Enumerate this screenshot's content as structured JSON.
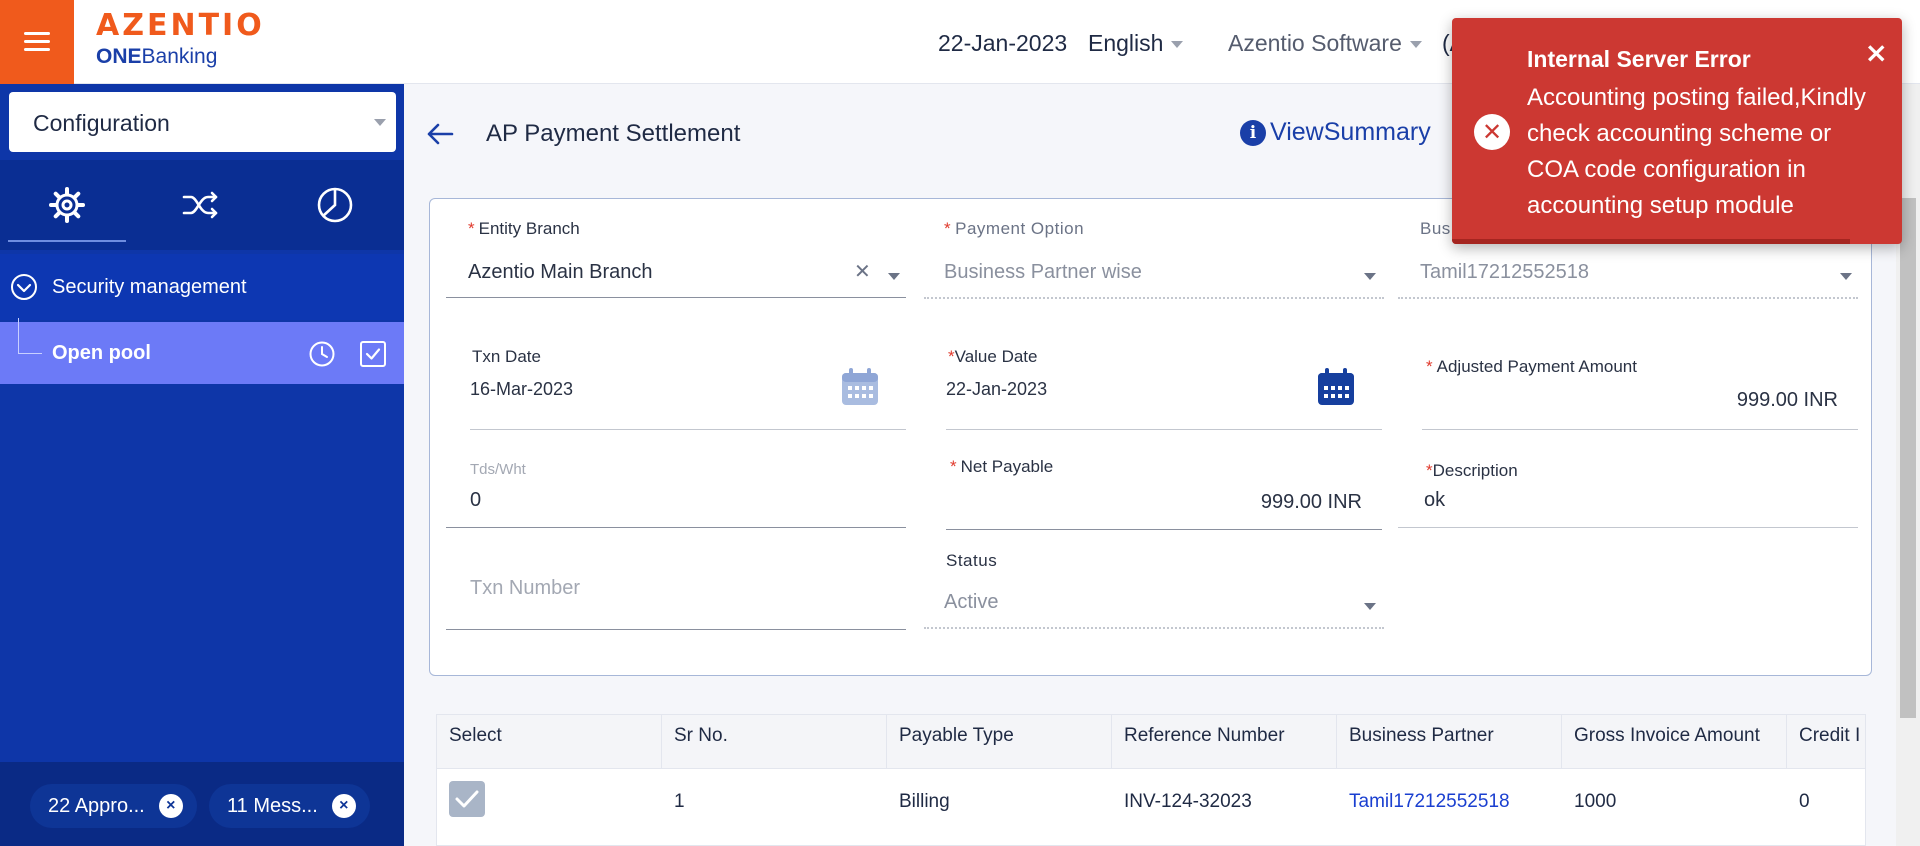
{
  "header": {
    "menu_icon": "hamburger-icon",
    "logo_main": "AZENTIO",
    "logo_sub_bold": "ONE",
    "logo_sub": "Banking",
    "date": "22-Jan-2023",
    "language": "English",
    "company": "Azentio Software",
    "extra": "(A"
  },
  "sidebar": {
    "module": "Configuration",
    "tabs": [
      {
        "icon": "gear-icon"
      },
      {
        "icon": "shuffle-icon"
      },
      {
        "icon": "pie-chart-icon"
      }
    ],
    "group_label": "Security management",
    "item_label": "Open pool",
    "footer": {
      "approvals": "22 Appro...",
      "messages": "11 Mess..."
    }
  },
  "page": {
    "title": "AP Payment Settlement",
    "view_summary": "ViewSummary"
  },
  "form": {
    "entity_branch_label": "Entity Branch",
    "entity_branch_value": "Azentio Main Branch",
    "payment_option_label": "Payment Option",
    "payment_option_value": "Business Partner wise",
    "business_partner_label": "Bus",
    "business_partner_value": "Tamil17212552518",
    "txn_date_label": "Txn Date",
    "txn_date_value": "16-Mar-2023",
    "value_date_label": "Value Date",
    "value_date_value": "22-Jan-2023",
    "adjusted_amount_label": "Adjusted Payment Amount",
    "adjusted_amount_value": "999.00 INR",
    "tds_label": "Tds/Wht",
    "tds_value": "0",
    "net_payable_label": "Net Payable",
    "net_payable_value": "999.00 INR",
    "description_label": "Description",
    "description_value": "ok",
    "txn_number_placeholder": "Txn Number",
    "status_label": "Status",
    "status_value": "Active"
  },
  "table": {
    "headers": [
      "Select",
      "Sr No.",
      "Payable Type",
      "Reference Number",
      "Business Partner",
      "Gross Invoice Amount",
      "Credit I"
    ],
    "rows": [
      {
        "sr": "1",
        "payable_type": "Billing",
        "reference": "INV-124-32023",
        "partner": "Tamil17212552518",
        "gross": "1000",
        "credit": "0"
      }
    ]
  },
  "toast": {
    "title": "Internal Server Error",
    "message": "Accounting posting failed,Kindly check accounting scheme or COA code configuration in accounting setup module",
    "close": "×"
  }
}
